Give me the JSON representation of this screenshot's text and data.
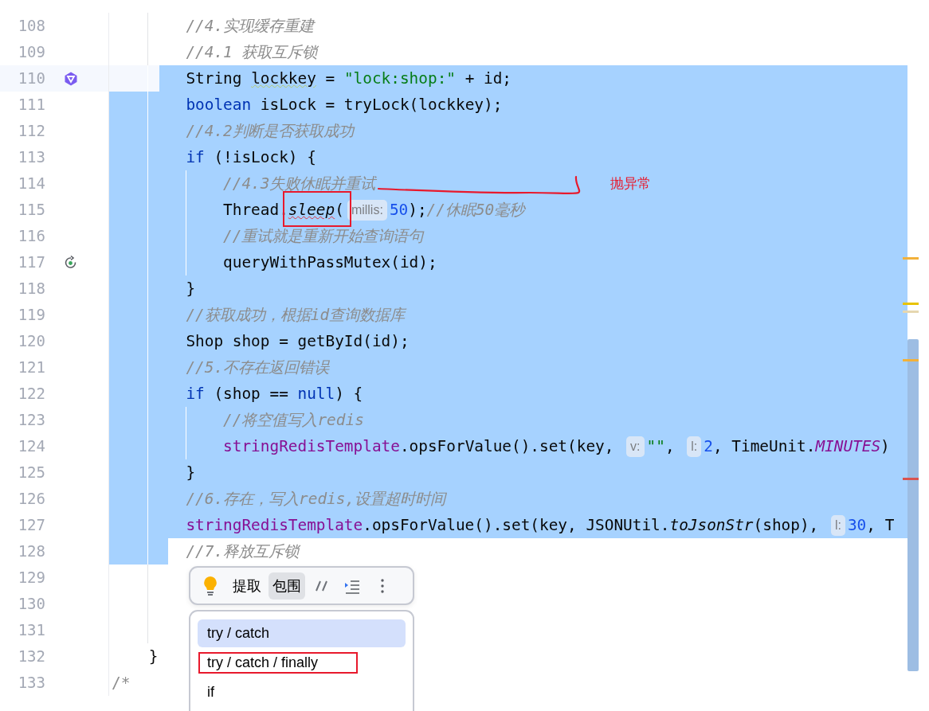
{
  "editor": {
    "lines": [
      {
        "number": "108",
        "kind": "code",
        "selected": false,
        "tokens": [
          {
            "kind": "comment",
            "text": "        //4.实现缓存重建"
          }
        ]
      },
      {
        "number": "109",
        "kind": "code",
        "selected": false,
        "tokens": [
          {
            "kind": "comment",
            "text": "        //4.1 获取互斥锁"
          }
        ]
      },
      {
        "number": "110",
        "kind": "ai",
        "selected": true,
        "partial": true,
        "current": true,
        "tokens": [
          {
            "kind": "plain",
            "text": "        String "
          },
          {
            "kind": "plain",
            "text": "lockkey",
            "typo": true
          },
          {
            "kind": "plain",
            "text": " = "
          },
          {
            "kind": "string",
            "text": "\"lock:shop:\""
          },
          {
            "kind": "plain",
            "text": " + id;"
          }
        ]
      },
      {
        "number": "111",
        "kind": "code",
        "selected": true,
        "tokens": [
          {
            "kind": "keyword",
            "text": "        boolean"
          },
          {
            "kind": "plain",
            "text": " isLock = tryLock(lockkey);"
          }
        ]
      },
      {
        "number": "112",
        "kind": "code",
        "selected": true,
        "tokens": [
          {
            "kind": "comment",
            "text": "        //4.2判断是否获取成功"
          }
        ]
      },
      {
        "number": "113",
        "kind": "code",
        "selected": true,
        "tokens": [
          {
            "kind": "keyword",
            "text": "        if"
          },
          {
            "kind": "plain",
            "text": " (!isLock) {"
          }
        ]
      },
      {
        "number": "114",
        "kind": "code",
        "selected": true,
        "tokens": [
          {
            "kind": "comment",
            "text": "            //4.3失败休眠并重试"
          }
        ]
      },
      {
        "number": "115",
        "kind": "code",
        "selected": true,
        "tokens": [
          {
            "kind": "plain",
            "text": "            Thread."
          },
          {
            "kind": "static",
            "text": "sleep",
            "error": true
          },
          {
            "kind": "plain",
            "text": "("
          },
          {
            "kind": "hint",
            "text": "millis:"
          },
          {
            "kind": "number",
            "text": "50"
          },
          {
            "kind": "plain",
            "text": ");"
          },
          {
            "kind": "comment",
            "text": "//休眠50毫秒"
          }
        ]
      },
      {
        "number": "116",
        "kind": "code",
        "selected": true,
        "tokens": [
          {
            "kind": "comment",
            "text": "            //重试就是重新开始查询语句"
          }
        ]
      },
      {
        "number": "117",
        "kind": "recursive_call",
        "selected": true,
        "tokens": [
          {
            "kind": "plain",
            "text": "            queryWithPassMutex(id);"
          }
        ]
      },
      {
        "number": "118",
        "kind": "code",
        "selected": true,
        "tokens": [
          {
            "kind": "plain",
            "text": "        }"
          }
        ]
      },
      {
        "number": "119",
        "kind": "code",
        "selected": true,
        "tokens": [
          {
            "kind": "comment",
            "text": "        //获取成功，根据id查询数据库"
          }
        ]
      },
      {
        "number": "120",
        "kind": "code",
        "selected": true,
        "tokens": [
          {
            "kind": "plain",
            "text": "        Shop shop = getById(id);"
          }
        ]
      },
      {
        "number": "121",
        "kind": "code",
        "selected": true,
        "tokens": [
          {
            "kind": "comment",
            "text": "        //5.不存在返回错误"
          }
        ]
      },
      {
        "number": "122",
        "kind": "code",
        "selected": true,
        "tokens": [
          {
            "kind": "keyword",
            "text": "        if"
          },
          {
            "kind": "plain",
            "text": " (shop == "
          },
          {
            "kind": "keyword",
            "text": "null"
          },
          {
            "kind": "plain",
            "text": ") {"
          }
        ]
      },
      {
        "number": "123",
        "kind": "code",
        "selected": true,
        "tokens": [
          {
            "kind": "comment",
            "text": "            //将空值写入redis"
          }
        ]
      },
      {
        "number": "124",
        "kind": "code",
        "selected": true,
        "tokens": [
          {
            "kind": "field",
            "text": "            stringRedisTemplate"
          },
          {
            "kind": "plain",
            "text": ".opsForValue().set(key, "
          },
          {
            "kind": "hint",
            "text": "v:"
          },
          {
            "kind": "string",
            "text": "\"\""
          },
          {
            "kind": "plain",
            "text": ", "
          },
          {
            "kind": "hint",
            "text": "l:"
          },
          {
            "kind": "number",
            "text": "2"
          },
          {
            "kind": "plain",
            "text": ", TimeUnit."
          },
          {
            "kind": "static_field",
            "text": "MINUTES"
          },
          {
            "kind": "plain",
            "text": ")"
          }
        ]
      },
      {
        "number": "125",
        "kind": "code",
        "selected": true,
        "tokens": [
          {
            "kind": "plain",
            "text": "        }"
          }
        ]
      },
      {
        "number": "126",
        "kind": "code",
        "selected": true,
        "tokens": [
          {
            "kind": "comment",
            "text": "        //6.存在，写入redis,设置超时时间"
          }
        ]
      },
      {
        "number": "127",
        "kind": "code",
        "selected": true,
        "tokens": [
          {
            "kind": "field",
            "text": "        stringRedisTemplate"
          },
          {
            "kind": "plain",
            "text": ".opsForValue().set(key, JSONUtil."
          },
          {
            "kind": "static",
            "text": "toJsonStr"
          },
          {
            "kind": "plain",
            "text": "(shop), "
          },
          {
            "kind": "hint",
            "text": "l:"
          },
          {
            "kind": "number",
            "text": "30"
          },
          {
            "kind": "plain",
            "text": ", T"
          }
        ]
      },
      {
        "number": "128",
        "kind": "code",
        "selected": true,
        "partial": true,
        "tokens": [
          {
            "kind": "comment",
            "text": "        //7.释放互斥锁"
          }
        ]
      },
      {
        "number": "129",
        "kind": "code",
        "selected": false
      },
      {
        "number": "130",
        "kind": "code",
        "selected": false
      },
      {
        "number": "131",
        "kind": "code",
        "selected": false
      },
      {
        "number": "132",
        "kind": "code",
        "selected": false,
        "tokens": [
          {
            "kind": "plain",
            "text": "    }"
          }
        ]
      },
      {
        "number": "133",
        "kind": "code",
        "selected": false,
        "tokens": [
          {
            "kind": "comment_plain",
            "text": "/*"
          }
        ]
      }
    ],
    "error_stripe": [
      {
        "color": "#f2b13a"
      },
      {
        "color": "#e8c300"
      },
      {
        "color": "#e6d7b0"
      },
      {
        "color": "#f2b13a"
      },
      {
        "color": "#d9534f"
      }
    ]
  },
  "annotations": {
    "note": "抛异常"
  },
  "intention_toolbar": {
    "buttons": [
      {
        "label": "提取",
        "selected": false
      },
      {
        "label": "包围",
        "selected": true
      }
    ]
  },
  "surround_menu": {
    "items": [
      {
        "label": "try / catch",
        "selected": true,
        "annotated": false
      },
      {
        "label": "try / catch / finally",
        "selected": false,
        "annotated": true
      },
      {
        "label": "if",
        "selected": false,
        "annotated": false
      }
    ]
  }
}
